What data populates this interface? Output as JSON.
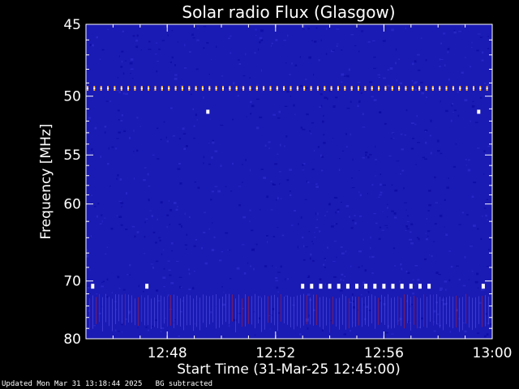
{
  "chart_data": {
    "type": "heatmap",
    "title": "Solar radio Flux (Glasgow)",
    "ylabel": "Frequency [MHz]",
    "xlabel": "Start Time (31-Mar-25 12:45:00)",
    "y_scale": "reciprocal",
    "ylim": [
      45,
      80
    ],
    "y_ticks": [
      45,
      50,
      55,
      60,
      70,
      80
    ],
    "y_tick_labels": [
      "45",
      "50",
      "55",
      "60",
      "70",
      "80"
    ],
    "x_range": [
      "12:45:00",
      "13:00:00"
    ],
    "x_ticks": [
      "12:48",
      "12:52",
      "12:56",
      "13:00"
    ],
    "colors": {
      "background": "#1a1ab4",
      "noise": "#0808a0",
      "hot": "#ffffff",
      "warm": "#ffb030",
      "rfi_red": "#c02020"
    },
    "interference_features": [
      {
        "description_type": "periodic_spikes",
        "frequency_mhz": 49.4,
        "time_range": [
          "12:45:00",
          "13:00:00"
        ],
        "period_s": 15
      },
      {
        "description_type": "spot",
        "frequency_mhz": 51.2,
        "time": "12:49:30"
      },
      {
        "description_type": "spot",
        "frequency_mhz": 51.2,
        "time": "12:59:30"
      },
      {
        "description_type": "band_segments",
        "frequency_mhz": 70.8,
        "times": [
          "12:45:15",
          "12:47:15",
          "12:53:00",
          "12:53:20",
          "12:53:40",
          "12:54:00",
          "12:54:20",
          "12:54:40",
          "12:55:00",
          "12:55:20",
          "12:55:40",
          "12:56:00",
          "12:56:20",
          "12:56:40",
          "12:57:00",
          "12:57:20",
          "12:57:40",
          "12:59:40"
        ]
      },
      {
        "description_type": "rfi_band",
        "frequency_range_mhz": [
          72,
          78
        ],
        "time_range": [
          "12:45:00",
          "13:00:00"
        ]
      }
    ]
  },
  "footer": {
    "updated": "Updated Mon Mar 31 13:18:44 2025",
    "note": "BG subtracted"
  }
}
